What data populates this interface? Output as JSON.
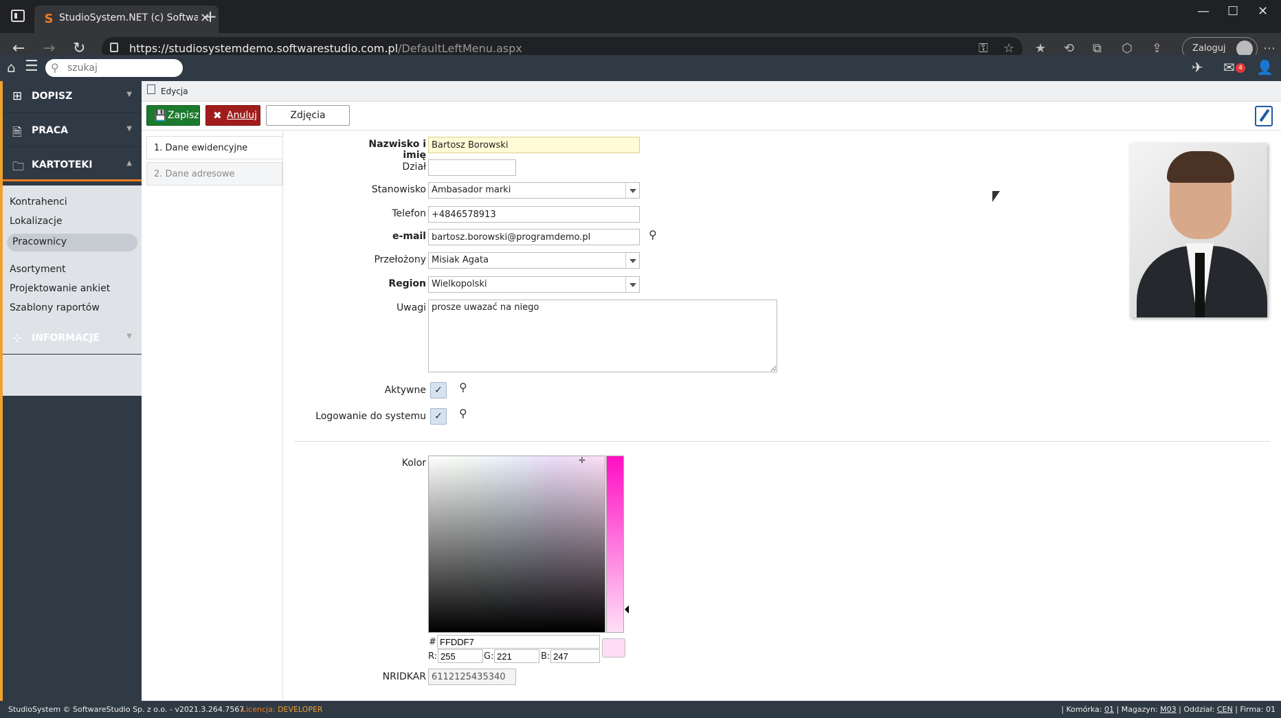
{
  "browser": {
    "tab_title": "StudioSystem.NET (c) SoftwareSt",
    "url_host": "https://studiosystemdemo.softwarestudio.com.pl",
    "url_path": "/DefaultLeftMenu.aspx",
    "login_label": "Zaloguj"
  },
  "appbar": {
    "search_placeholder": "szukaj",
    "mail_count": "4"
  },
  "sidebar": {
    "sections": [
      {
        "label": "DOPISZ"
      },
      {
        "label": "PRACA"
      },
      {
        "label": "KARTOTEKI"
      },
      {
        "label": "INFORMACJE"
      }
    ],
    "items": [
      "Kontrahenci",
      "Lokalizacje",
      "Pracownicy",
      "Asortyment",
      "Projektowanie ankiet",
      "Szablony raportów"
    ]
  },
  "breadcrumb": "Edycja",
  "toolbar": {
    "save": "Zapisz",
    "cancel": "Anuluj",
    "photos": "Zdjęcia"
  },
  "tabs": [
    "1. Dane ewidencyjne",
    "2. Dane adresowe"
  ],
  "form": {
    "name_label": "Nazwisko i imię",
    "name_value": "Bartosz Borowski",
    "dept_label": "Dział",
    "dept_value": "",
    "position_label": "Stanowisko",
    "position_value": "Ambasador marki",
    "phone_label": "Telefon",
    "phone_value": "+4846578913",
    "email_label": "e-mail",
    "email_value": "bartosz.borowski@programdemo.pl",
    "supervisor_label": "Przełożony",
    "supervisor_value": "Misiak Agata",
    "region_label": "Region",
    "region_value": "Wielkopolski",
    "notes_label": "Uwagi",
    "notes_value": "prosze uwazać na niego",
    "active_label": "Aktywne",
    "active_checked": true,
    "login_label": "Logowanie do systemu",
    "login_checked": true,
    "color_label": "Kolor",
    "hex_prefix": "#",
    "hex_value": "FFDDF7",
    "r_label": "R:",
    "r_value": "255",
    "g_label": "G:",
    "g_value": "221",
    "b_label": "B:",
    "b_value": "247",
    "swatch_color": "#ffddf7",
    "nridkar_label": "NRIDKAR",
    "nridkar_value": "6112125435340"
  },
  "status": {
    "left": "StudioSystem © SoftwareStudio Sp. z o.o. - v2021.3.264.7567",
    "license_label": "Licencja:",
    "license_value": "DEVELOPER",
    "komorka_label": "Komórka:",
    "komorka": "01",
    "magazyn_label": "Magazyn:",
    "magazyn": "M03",
    "oddzial_label": "Oddział:",
    "oddzial": "CEN",
    "firma_label": "Firma:",
    "firma": "01"
  }
}
